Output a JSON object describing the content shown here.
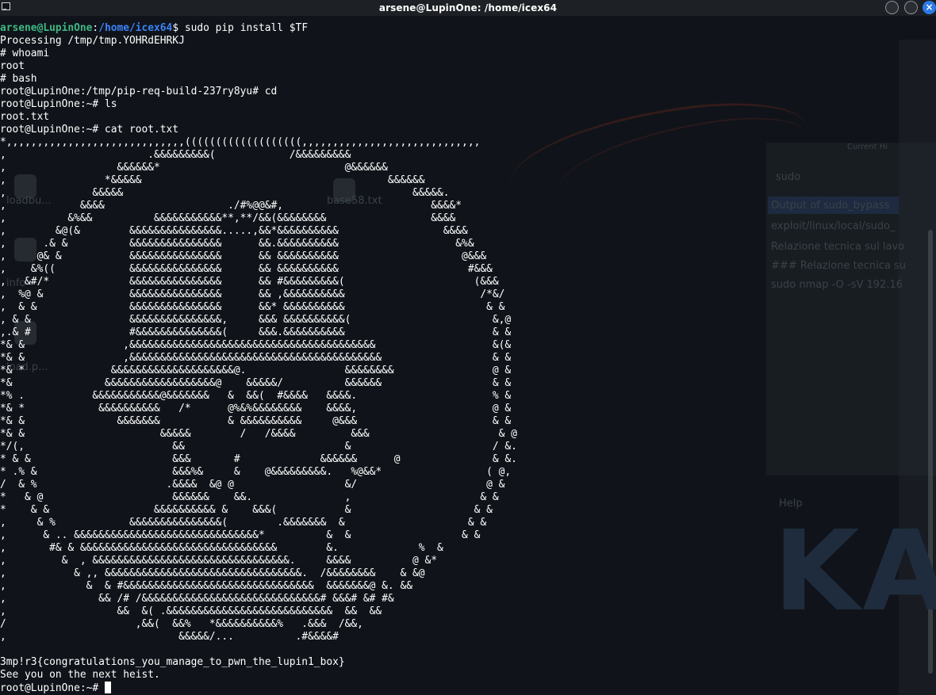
{
  "window": {
    "title": "arsene@LupinOne: /home/icex64",
    "close_glyph": "×"
  },
  "terminal": {
    "prompt_user": "arsene@LupinOne",
    "prompt_sep": ":",
    "prompt_path": "/home/icex64",
    "prompt_symbol": "$ ",
    "first_command": "sudo pip install $TF",
    "lines": [
      "Processing /tmp/tmp.YOHRdEHRKJ",
      "# whoami",
      "root",
      "# bash",
      "root@LupinOne:/tmp/pip-req-build-237ry8yu# cd",
      "root@LupinOne:~# ls",
      "root.txt",
      "root@LupinOne:~# cat root.txt",
      "*,,,,,,,,,,,,,,,,,,,,,,,,,,,,,(((((((((((((((((((,,,,,,,,,,,,,,,,,,,,,,,,,,,,,",
      ",                       .&&&&&&&&&(            /&&&&&&&&&",
      ",                  &&&&&&*                              @&&&&&&",
      ",                *&&&&&                                        &&&&&&",
      ",              &&&&&                                               &&&&&.",
      ",            &&&&                    ./#%@@&#,                        &&&&*",
      ",          &%&&          &&&&&&&&&&&**,**/&&(&&&&&&&&                 &&&&",
      ",        &@(&        &&&&&&&&&&&&&&&.....,&&*&&&&&&&&&&                 &&&&",
      ",      .& &          &&&&&&&&&&&&&&&      &&.&&&&&&&&&&                   &%&",
      ",     @& &           &&&&&&&&&&&&&&&      && &&&&&&&&&&                    @&&&",
      ",    &%((            &&&&&&&&&&&&&&&      && &&&&&&&&&&                     #&&&",
      ",   &#/*             &&&&&&&&&&&&&&&      && #&&&&&&&&&(                     (&&&",
      ",  %@ &              &&&&&&&&&&&&&&&      && ,&&&&&&&&&&                      /*&/",
      ",  & &               &&&&&&&&&&&&&&&      &&* &&&&&&&&&&                       & &",
      ", & &                &&&&&&&&&&&&&&&,     &&& &&&&&&&&&&(                       &,@",
      ",.& #                #&&&&&&&&&&&&&&(     &&&.&&&&&&&&&&                        & &",
      "*& &                ,&&&&&&&&&&&&&&&&&&&&&&&&&&&&&&&&&&&&&&&&                   &(&",
      "*& &                ,&&&&&&&&&&&&&&&&&&&&&&&&&&&&&&&&&&&&&&&&&                  & &",
      "*& *              &&&&&&&&&&&&&&&&&&&&@.                &&&&&&&&                @ &",
      "*&               &&&&&&&&&&&&&&&&&&@    &&&&&/          &&&&&&                  & &",
      "*% .           &&&&&&&&&&&@&&&&&&&   &  &&(  #&&&&   &&&&.                      % &",
      "*& *            &&&&&&&&&&   /*      @%&%&&&&&&&&    &&&&,                      @ &",
      "*& &               &&&&&&&           & &&&&&&&&&&     @&&&                      & &",
      "*& &                      &&&&&        /   /&&&&         &&&                     & @",
      "*/(,                        &&                          &                       / &.",
      "* & &                       &&&       #             &&&&&&      @               & &.",
      "* .% &                      &&&%&     &    @&&&&&&&&&.   %@&&*                 ( @,",
      "/  & %                     .&&&&  &@ @                  &/                     @ &",
      "*   & @                     &&&&&&    &&.               ,                     & &",
      "*    & &                 &&&&&&&&&& &    &&&(           &                    & &",
      ",     & %            &&&&&&&&&&&&&&&(        .&&&&&&&  &                    & &",
      ",      & .. &&&&&&&&&&&&&&&&&&&&&&&&&&&&&&*          &  &                  & &",
      ",       #& & &&&&&&&&&&&&&&&&&&&&&&&&&&&&&&&&        &.             %  &",
      ",         &  , &&&&&&&&&&&&&&&&&&&&&&&&&&&&&&&&.     &&&&          @ &*",
      ",           & ,, &&&&&&&&&&&&&&&&&&&&&&&&&&&&&&&&.  /&&&&&&&&    & &@",
      ",             &  & #&&&&&&&&&&&&&&&&&&&&&&&&&&&&&&&  &&&&&&&@ &. &&",
      ",               && /# /&&&&&&&&&&&&&&&&&&&&&&&&&&&&&# &&&# &# #&",
      ",                  &&  &( .&&&&&&&&&&&&&&&&&&&&&&&&&&&  &&  &&",
      "/                     ,&&(  &&%   *&&&&&&&&&&%   .&&&  /&&,",
      ",                            &&&&&/...          .#&&&&#",
      "",
      "3mp!r3{congratulations_you_manage_to_pwn_the_lupin1_box}",
      "See you on the next heist."
    ],
    "final_prompt": "root@LupinOne:~# "
  },
  "background_desktop": {
    "search_text": "sudo",
    "file_labels": [
      "loadbu...",
      "base58.txt",
      "info",
      "load.p..."
    ],
    "list_items": [
      "Output of sudo_bypass",
      "exploit/linux/local/sudo_",
      "Relazione tecnica sul lavo",
      "### Relazione tecnica su",
      "sudo nmap -O -sV 192.16"
    ],
    "help_label": "Help",
    "header_label": "Current Hi",
    "logo_text": "KA"
  }
}
